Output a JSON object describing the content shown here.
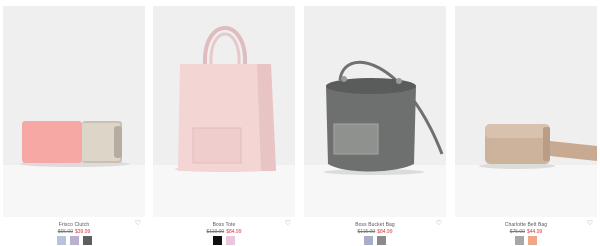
{
  "products": [
    {
      "name": "Frisco Clutch",
      "old_price": "$65.00",
      "new_price": "$39.99",
      "swatches": [
        "#b9c3dd",
        "#b9b2cf",
        "#5e5e60"
      ]
    },
    {
      "name": "Boss Tote",
      "old_price": "$119.00",
      "new_price": "$84.99",
      "swatches": [
        "#111111",
        "#e9c6dd"
      ]
    },
    {
      "name": "Boss Bucket Bag",
      "old_price": "$115.00",
      "new_price": "$84.99",
      "swatches": [
        "#a9aec8",
        "#8a8a8a"
      ]
    },
    {
      "name": "Charlotte Belt Bag",
      "old_price": "$75.00",
      "new_price": "$44.99",
      "swatches": [
        "#a7a7a7",
        "#f0a788"
      ]
    }
  ],
  "icons": {
    "favorite": "heart-icon"
  },
  "colors": {
    "sale_price": "#d8343e",
    "card_bg": "#efefef"
  }
}
